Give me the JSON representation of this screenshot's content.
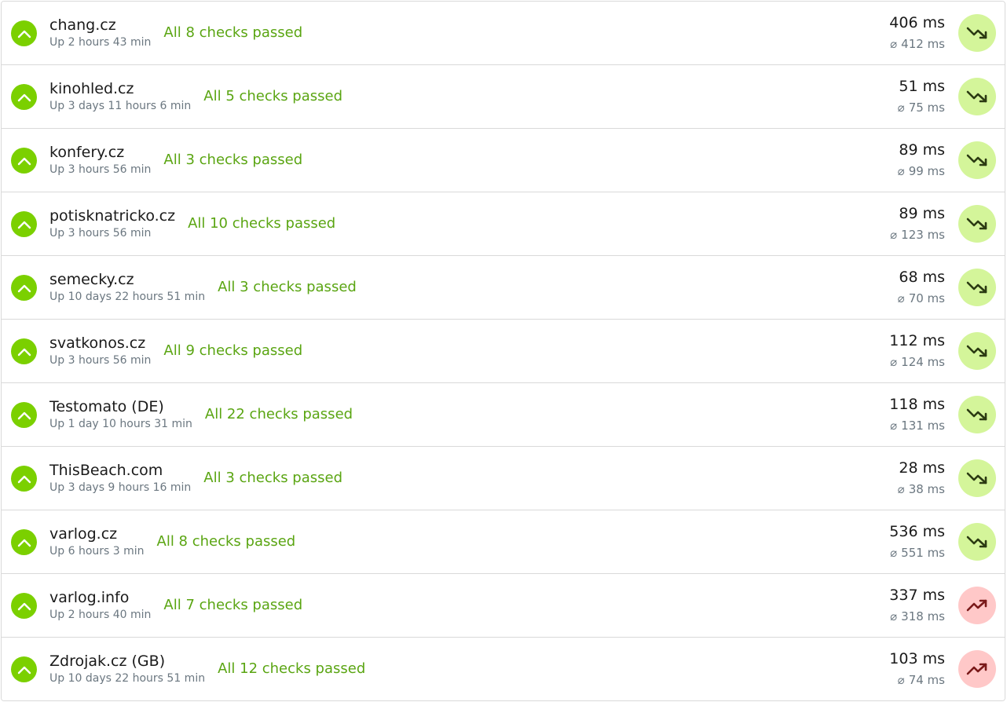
{
  "colors": {
    "status_up": "#7bd000",
    "checks_text": "#5aa512",
    "trend_down_bg": "#d4f59a",
    "trend_down_icon": "#2b3a12",
    "trend_up_bg": "#ffc8c8",
    "trend_up_icon": "#7a1a1a"
  },
  "avg_symbol": "⌀",
  "monitors": [
    {
      "name": "chang.cz",
      "uptime": "Up 2 hours 43 min",
      "checks": "All 8 checks passed",
      "current": "406 ms",
      "average": "412 ms",
      "status_icon": "chevron-up-icon",
      "trend": "down",
      "trend_icon": "trend-down-icon"
    },
    {
      "name": "kinohled.cz",
      "uptime": "Up 3 days 11 hours 6 min",
      "checks": "All 5 checks passed",
      "current": "51 ms",
      "average": "75 ms",
      "status_icon": "chevron-up-icon",
      "trend": "down",
      "trend_icon": "trend-down-icon"
    },
    {
      "name": "konfery.cz",
      "uptime": "Up 3 hours 56 min",
      "checks": "All 3 checks passed",
      "current": "89 ms",
      "average": "99 ms",
      "status_icon": "chevron-up-icon",
      "trend": "down",
      "trend_icon": "trend-down-icon"
    },
    {
      "name": "potisknatricko.cz",
      "uptime": "Up 3 hours 56 min",
      "checks": "All 10 checks passed",
      "current": "89 ms",
      "average": "123 ms",
      "status_icon": "chevron-up-icon",
      "trend": "down",
      "trend_icon": "trend-down-icon"
    },
    {
      "name": "semecky.cz",
      "uptime": "Up 10 days 22 hours 51 min",
      "checks": "All 3 checks passed",
      "current": "68 ms",
      "average": "70 ms",
      "status_icon": "chevron-up-icon",
      "trend": "down",
      "trend_icon": "trend-down-icon"
    },
    {
      "name": "svatkonos.cz",
      "uptime": "Up 3 hours 56 min",
      "checks": "All 9 checks passed",
      "current": "112 ms",
      "average": "124 ms",
      "status_icon": "chevron-up-icon",
      "trend": "down",
      "trend_icon": "trend-down-icon"
    },
    {
      "name": "Testomato (DE)",
      "uptime": "Up 1 day 10 hours 31 min",
      "checks": "All 22 checks passed",
      "current": "118 ms",
      "average": "131 ms",
      "status_icon": "chevron-up-icon",
      "trend": "down",
      "trend_icon": "trend-down-icon"
    },
    {
      "name": "ThisBeach.com",
      "uptime": "Up 3 days 9 hours 16 min",
      "checks": "All 3 checks passed",
      "current": "28 ms",
      "average": "38 ms",
      "status_icon": "chevron-up-icon",
      "trend": "down",
      "trend_icon": "trend-down-icon"
    },
    {
      "name": "varlog.cz",
      "uptime": "Up 6 hours 3 min",
      "checks": "All 8 checks passed",
      "current": "536 ms",
      "average": "551 ms",
      "status_icon": "chevron-up-icon",
      "trend": "down",
      "trend_icon": "trend-down-icon"
    },
    {
      "name": "varlog.info",
      "uptime": "Up 2 hours 40 min",
      "checks": "All 7 checks passed",
      "current": "337 ms",
      "average": "318 ms",
      "status_icon": "chevron-up-icon",
      "trend": "up",
      "trend_icon": "trend-up-icon"
    },
    {
      "name": "Zdrojak.cz (GB)",
      "uptime": "Up 10 days 22 hours 51 min",
      "checks": "All 12 checks passed",
      "current": "103 ms",
      "average": "74 ms",
      "status_icon": "chevron-up-icon",
      "trend": "up",
      "trend_icon": "trend-up-icon"
    }
  ]
}
